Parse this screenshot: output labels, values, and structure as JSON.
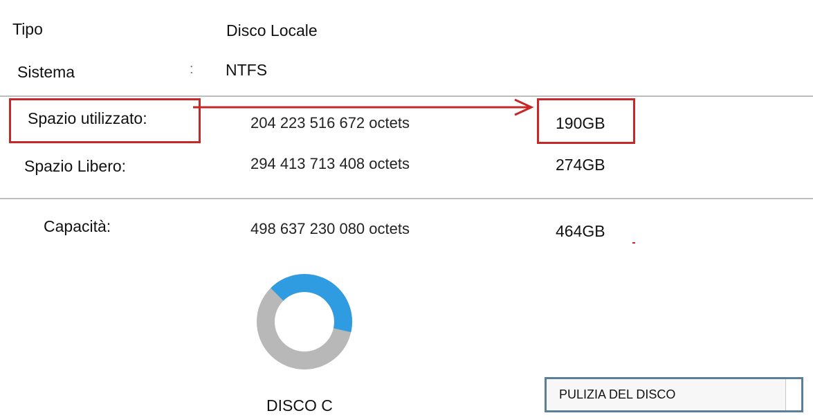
{
  "rows": {
    "type": {
      "label": "Tipo",
      "value": "Disco Locale"
    },
    "system": {
      "label": "Sistema",
      "separator": ":",
      "value": "NTFS"
    },
    "used": {
      "label": "Spazio utilizzato:",
      "bytes": "204 223 516 672 octets",
      "gb": "190GB"
    },
    "free": {
      "label": "Spazio Libero:",
      "bytes": "294 413 713 408 octets",
      "gb": "274GB"
    },
    "capacity": {
      "label": "Capacità:",
      "bytes": "498 637 230 080 octets",
      "gb": "464GB"
    }
  },
  "chart": {
    "used_fraction": 0.4096,
    "colors": {
      "used": "#2f9be0",
      "free": "#b8b8b8"
    }
  },
  "disk": {
    "label": "DISCO C"
  },
  "actions": {
    "cleanup_label": "PULIZIA DEL DISCO"
  },
  "colors": {
    "highlight": "#c62828",
    "button_border": "#5a7f99"
  }
}
